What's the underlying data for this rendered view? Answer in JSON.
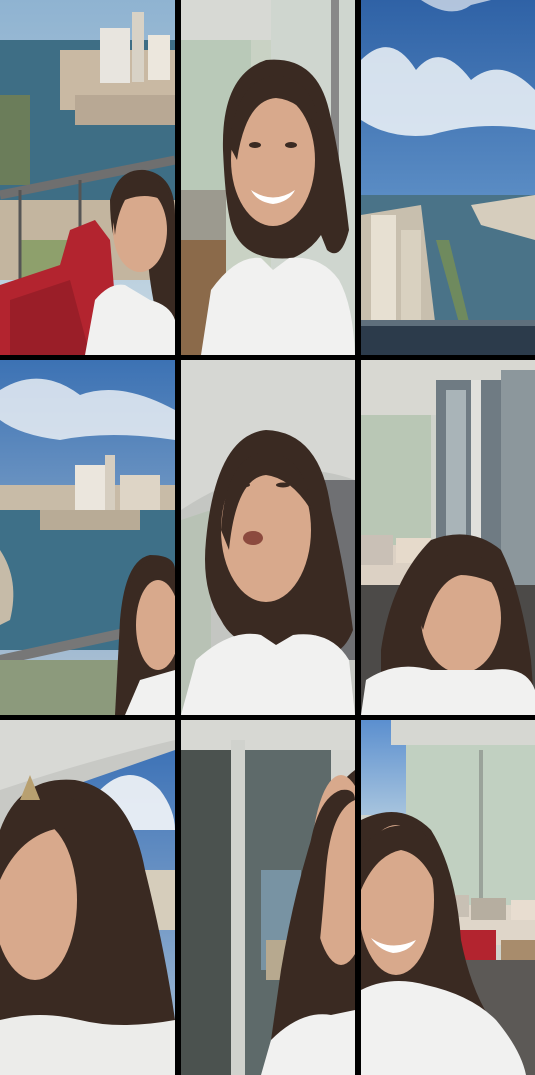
{
  "tiles": [
    {
      "scene": "balcony-city-view-with-red-cushion-chair"
    },
    {
      "scene": "smiling-woman-on-balcony"
    },
    {
      "scene": "sky-and-waterway-city-view"
    },
    {
      "scene": "city-waterway-view-woman-at-edge"
    },
    {
      "scene": "woman-talking-under-ceiling"
    },
    {
      "scene": "balcony-with-sofa-woman-looking-down"
    },
    {
      "scene": "woman-close-up-balcony-sky"
    },
    {
      "scene": "woman-by-glass-door"
    },
    {
      "scene": "smiling-woman-balcony-furniture"
    }
  ],
  "colors": {
    "background": "#000000",
    "sky": "#4e7fb8",
    "water": "#3d6b86",
    "hair": "#3a2a22",
    "skin": "#d8a98c",
    "shirt": "#f1f1f0",
    "cushion": "#b3242f"
  }
}
